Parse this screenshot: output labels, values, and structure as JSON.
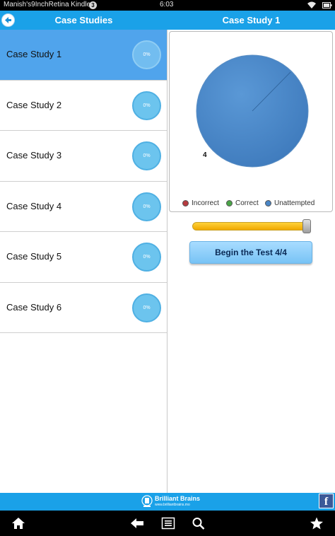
{
  "status_bar": {
    "device_name": "Manish's9InchRetina Kindle",
    "notification_count": "3",
    "time": "6:03"
  },
  "header": {
    "left_title": "Case Studies",
    "right_title": "Case Study 1"
  },
  "case_studies": [
    {
      "label": "Case Study 1",
      "progress": "0%",
      "selected": true
    },
    {
      "label": "Case Study 2",
      "progress": "0%",
      "selected": false
    },
    {
      "label": "Case Study 3",
      "progress": "0%",
      "selected": false
    },
    {
      "label": "Case Study 4",
      "progress": "0%",
      "selected": false
    },
    {
      "label": "Case Study 5",
      "progress": "0%",
      "selected": false
    },
    {
      "label": "Case Study 6",
      "progress": "0%",
      "selected": false
    }
  ],
  "chart": {
    "slice_label": "4",
    "legend": [
      {
        "label": "Incorrect",
        "color": "#b63a3f"
      },
      {
        "label": "Correct",
        "color": "#4aa548"
      },
      {
        "label": "Unattempted",
        "color": "#4a86c6"
      }
    ]
  },
  "slider": {
    "value_fraction": 1.0
  },
  "begin_button": {
    "label": "Begin the Test 4/4"
  },
  "footer": {
    "brand_name": "Brilliant Brains",
    "brand_url": "www.brilliantbrains.mo",
    "facebook_glyph": "f"
  },
  "colors": {
    "header_blue": "#1aa1e8",
    "selected_row": "#50a4ec",
    "pie_fill": "#4a86c6",
    "slider_fill": "#f5b800"
  },
  "icons": [
    "back-arrow-icon",
    "wifi-icon",
    "battery-icon",
    "home-icon",
    "back-icon",
    "menu-icon",
    "search-icon",
    "star-icon",
    "facebook-icon",
    "brand-logo-icon"
  ]
}
